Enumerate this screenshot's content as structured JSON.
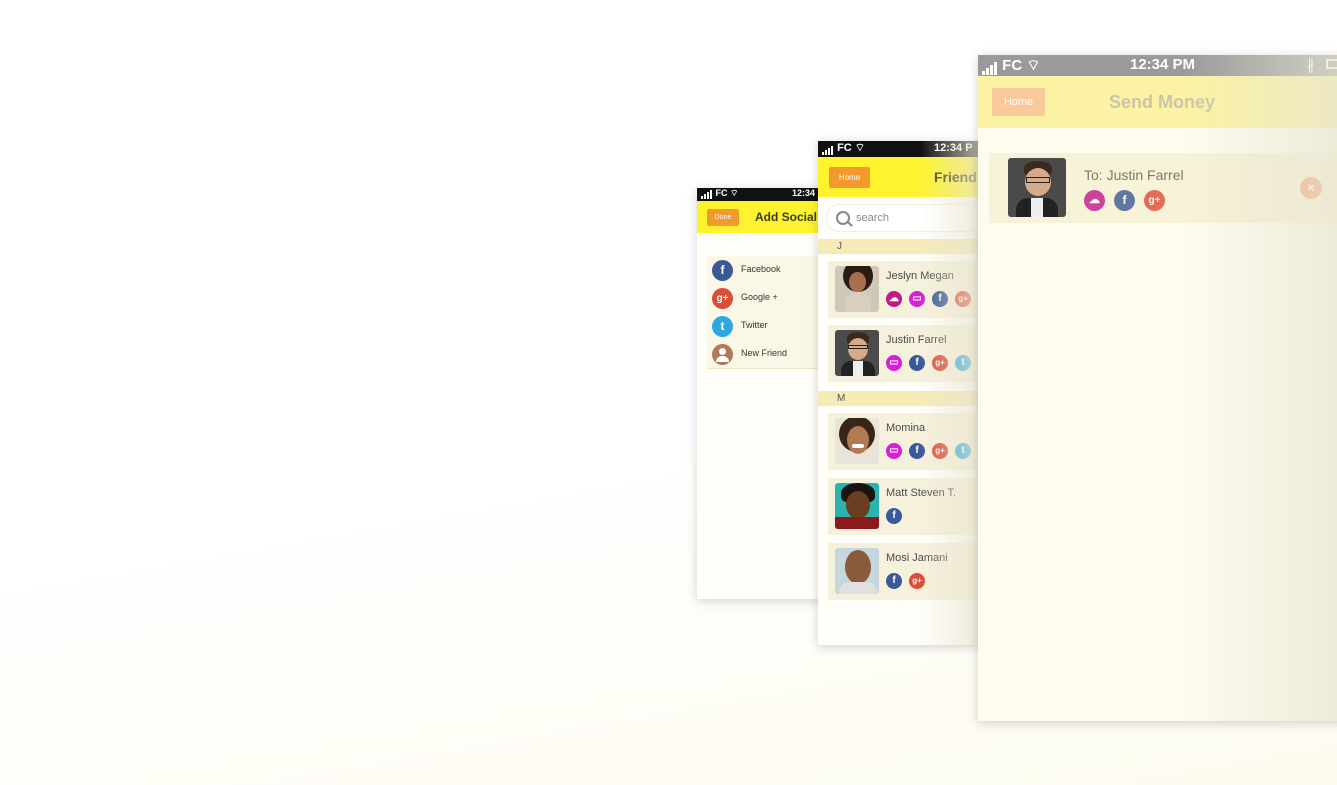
{
  "screen1": {
    "status": {
      "carrier": "FC",
      "time": "12:34"
    },
    "nav": {
      "button": "Done",
      "title": "Add Social"
    },
    "socials": [
      {
        "icon": "facebook-icon",
        "glyph": "f",
        "label": "Facebook"
      },
      {
        "icon": "google-plus-icon",
        "glyph": "g+",
        "label": "Google +"
      },
      {
        "icon": "twitter-icon",
        "glyph": "t",
        "label": "Twitter"
      },
      {
        "icon": "person-icon",
        "glyph": "",
        "label": "New Friend"
      }
    ]
  },
  "screen2": {
    "status": {
      "carrier": "FC",
      "time": "12:34 P"
    },
    "nav": {
      "button": "Home",
      "title": "Friend"
    },
    "search": {
      "placeholder": "search"
    },
    "sections": [
      {
        "letter": "J",
        "friends": [
          {
            "name": "Jeslyn Megan",
            "icons": [
              "ggl",
              "sms",
              "fb",
              "gp"
            ]
          },
          {
            "name": "Justin Farrel",
            "icons": [
              "sms",
              "fb",
              "gp",
              "tw"
            ]
          }
        ]
      },
      {
        "letter": "M",
        "friends": [
          {
            "name": "Momina",
            "icons": [
              "sms",
              "fb",
              "gp",
              "tw"
            ]
          },
          {
            "name": "Matt Steven T.",
            "icons": [
              "fb"
            ]
          },
          {
            "name": "Mosi Jamani",
            "icons": [
              "fb",
              "gp"
            ]
          }
        ]
      }
    ]
  },
  "screen3": {
    "status": {
      "carrier": "FC",
      "time": "12:34 PM"
    },
    "nav": {
      "button": "Home",
      "title": "Send Money"
    },
    "recipient": {
      "label": "To: Justin Farrel",
      "icons": [
        "ggl",
        "fb",
        "gp"
      ]
    }
  },
  "colors": {
    "navbar": "#fff330",
    "button": "#f39a2e",
    "facebook": "#3b5998",
    "google_plus": "#dd4b39",
    "twitter": "#2ca7e0",
    "sms": "#d61fd6"
  }
}
